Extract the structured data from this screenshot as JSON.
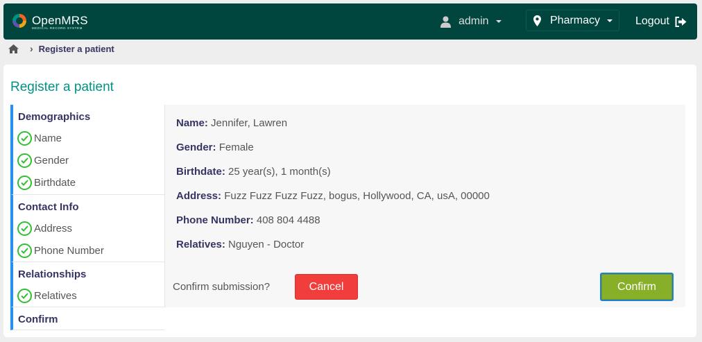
{
  "header": {
    "brand": "OpenMRS",
    "brand_subtitle": "MEDICAL RECORD SYSTEM",
    "user": "admin",
    "location": "Pharmacy",
    "logout": "Logout",
    "bg_color": "#00463f"
  },
  "breadcrumb": {
    "home_icon": "home-icon",
    "current": "Register a patient"
  },
  "page": {
    "title": "Register a patient"
  },
  "sidebar": {
    "sections": [
      {
        "title": "Demographics",
        "steps": [
          "Name",
          "Gender",
          "Birthdate"
        ]
      },
      {
        "title": "Contact Info",
        "steps": [
          "Address",
          "Phone Number"
        ]
      },
      {
        "title": "Relationships",
        "steps": [
          "Relatives"
        ]
      },
      {
        "title": "Confirm",
        "steps": []
      }
    ],
    "accent_color": "#1e90ff",
    "check_color": "#2fbf2f"
  },
  "summary": {
    "name_label": "Name:",
    "name_value": "Jennifer, Lawren",
    "gender_label": "Gender:",
    "gender_value": "Female",
    "birthdate_label": "Birthdate:",
    "birthdate_value": "25 year(s), 1 month(s)",
    "address_label": "Address:",
    "address_value": "Fuzz Fuzz Fuzz Fuzz, bogus, Hollywood, CA, usA, 00000",
    "phone_label": "Phone Number:",
    "phone_value": "408 804 4488",
    "relatives_label": "Relatives:",
    "relatives_value": "Nguyen - Doctor"
  },
  "actions": {
    "question": "Confirm submission?",
    "cancel": "Cancel",
    "confirm": "Confirm",
    "cancel_color": "#f23d3d",
    "confirm_color": "#88af28"
  }
}
